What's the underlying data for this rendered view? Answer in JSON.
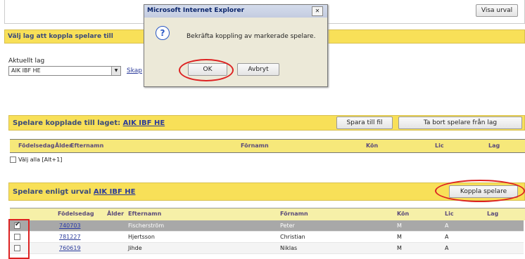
{
  "top": {
    "visa_urval": "Visa urval"
  },
  "valj_lag": {
    "header": "Välj lag att koppla spelare till",
    "aktuellt_lag_label": "Aktuellt lag",
    "selected_team": "AIK IBF HE",
    "skapa_link": "Skap"
  },
  "dialog": {
    "title": "Microsoft Internet Explorer",
    "message": "Bekräfta koppling av markerade spelare.",
    "ok": "OK",
    "cancel": "Avbryt",
    "close_glyph": "✕",
    "question_glyph": "?"
  },
  "kopplade": {
    "title_prefix": "Spelare kopplade till laget:",
    "team_link": "AIK IBF HE",
    "spara_button": "Spara till fil",
    "ta_bort_button": "Ta bort spelare från lag",
    "columns": [
      "Födelsedag",
      "Ålder",
      "Efternamn",
      "Förnamn",
      "Kön",
      "Lic",
      "Lag"
    ],
    "valj_alla": "Välj alla [Alt+1]"
  },
  "urval": {
    "title_prefix": "Spelare enligt urval",
    "team_link": "AIK IBF HE",
    "koppla_button": "Koppla spelare",
    "columns": [
      "Födelsedag",
      "Ålder",
      "Efternamn",
      "Förnamn",
      "Kön",
      "Lic",
      "Lag"
    ],
    "rows": [
      {
        "birth": "740703",
        "surname": "Fischerström",
        "firstname": "Peter",
        "sex": "M",
        "lic": "A",
        "checked": true
      },
      {
        "birth": "781227",
        "surname": "Hjertsson",
        "firstname": "Christian",
        "sex": "M",
        "lic": "A",
        "checked": false
      },
      {
        "birth": "760619",
        "surname": "Jihde",
        "firstname": "Niklas",
        "sex": "M",
        "lic": "A",
        "checked": false
      }
    ]
  },
  "colors": {
    "yellow": "#f8e058",
    "accent_red": "#dd2222",
    "dialog_title": "#0a246a"
  }
}
